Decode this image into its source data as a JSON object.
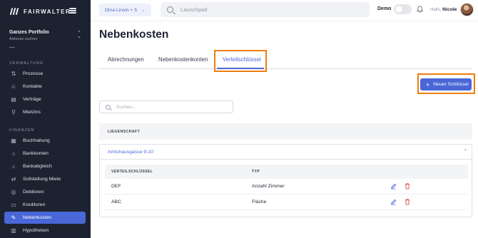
{
  "brand": {
    "name": "FAIRWALTER"
  },
  "portfolio": {
    "title": "Ganzes Portfolio",
    "subtitle": "Adresse suchen"
  },
  "sidebar": {
    "sections": [
      {
        "label": "VERWALTUNG"
      },
      {
        "label": "FINANZEN"
      }
    ],
    "items": [
      {
        "label": "Prozesse",
        "icon": "process-icon"
      },
      {
        "label": "Kontakte",
        "icon": "contacts-icon"
      },
      {
        "label": "Verträge",
        "icon": "contract-icon"
      },
      {
        "label": "Mietzins",
        "icon": "rent-icon"
      },
      {
        "label": "Buchhaltung",
        "icon": "accounting-icon"
      },
      {
        "label": "Bankkonten",
        "icon": "bank-icon"
      },
      {
        "label": "Bankabgleich",
        "icon": "bank-reconcile-icon"
      },
      {
        "label": "Sollstellung Miete",
        "icon": "rent-target-icon"
      },
      {
        "label": "Debitoren",
        "icon": "debtors-icon"
      },
      {
        "label": "Kreditoren",
        "icon": "creditors-icon"
      },
      {
        "label": "Nebenkosten",
        "icon": "utility-costs-icon",
        "active": true
      },
      {
        "label": "Hypotheken",
        "icon": "mortgage-icon"
      }
    ]
  },
  "topbar": {
    "user_select": "Dina Linsin + 5",
    "search_placeholder": "Launchpad",
    "demo_label": "Demo",
    "greeting": "Hallo,",
    "user_name": "Nicole"
  },
  "page": {
    "title": "Nebenkosten",
    "tabs": [
      {
        "label": "Abrechnungen"
      },
      {
        "label": "Nebenkostenkonten"
      },
      {
        "label": "Verteilschlüssel",
        "active": true
      }
    ],
    "new_button": "Neuer Schlüssel",
    "search_placeholder": "Suchen...",
    "table_header": "LIEGENSCHAFT",
    "group": {
      "name": "Amtshausgasse 9-10",
      "columns": [
        "VERTEILSCHLÜSSEL",
        "TYP"
      ],
      "rows": [
        {
          "key": "DEF",
          "type": "Anzahl Zimmer"
        },
        {
          "key": "ABC",
          "type": "Fläche"
        }
      ]
    }
  },
  "colors": {
    "accent": "#4a67d8",
    "sidebar_bg": "#1c2230",
    "highlight": "#f07c10",
    "delete": "#e04848"
  }
}
